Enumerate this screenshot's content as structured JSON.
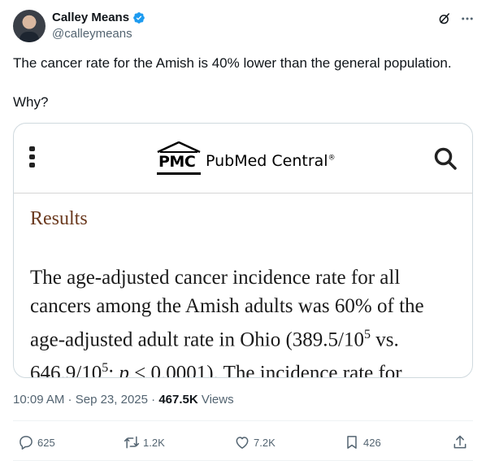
{
  "author": {
    "name": "Calley Means",
    "handle": "@calleymeans"
  },
  "icons": {
    "verified": "verified-badge-icon",
    "grok": "grok-icon",
    "more": "more-options-icon",
    "menu": "menu-dots-icon",
    "search": "search-icon",
    "reply": "reply-icon",
    "retweet": "retweet-icon",
    "like": "like-icon",
    "bookmark": "bookmark-icon",
    "share": "share-icon"
  },
  "colors": {
    "verified": "#1d9bf0",
    "text_primary": "#0f1419",
    "text_secondary": "#536471",
    "results_heading": "#6b3a1f"
  },
  "tweet": {
    "line1": "The cancer rate for the Amish is 40% lower than the general population.",
    "line2": "Why?"
  },
  "card": {
    "logo_mark": "PMC",
    "logo_name": "PubMed Central",
    "logo_reg": "®",
    "section_heading": "Results",
    "lines": [
      "The age-adjusted cancer incidence rate for all",
      "cancers among the Amish adults was 60% of the",
      "age-adjusted adult rate in Ohio (389.5/10",
      "646.9/10"
    ],
    "line3_sup": "5",
    "line3_tail": " vs.",
    "line4_sup": "5",
    "line4_tail": "; ",
    "line4_p": "p",
    "line4_end": " < 0.0001). The incidence rate for"
  },
  "meta": {
    "time": "10:09 AM",
    "sep1": " · ",
    "date": "Sep 23, 2025",
    "sep2": " · ",
    "views_count": "467.5K",
    "views_label": " Views"
  },
  "actions": {
    "replies": "625",
    "reposts": "1.2K",
    "likes": "7.2K",
    "bookmarks": "426"
  }
}
